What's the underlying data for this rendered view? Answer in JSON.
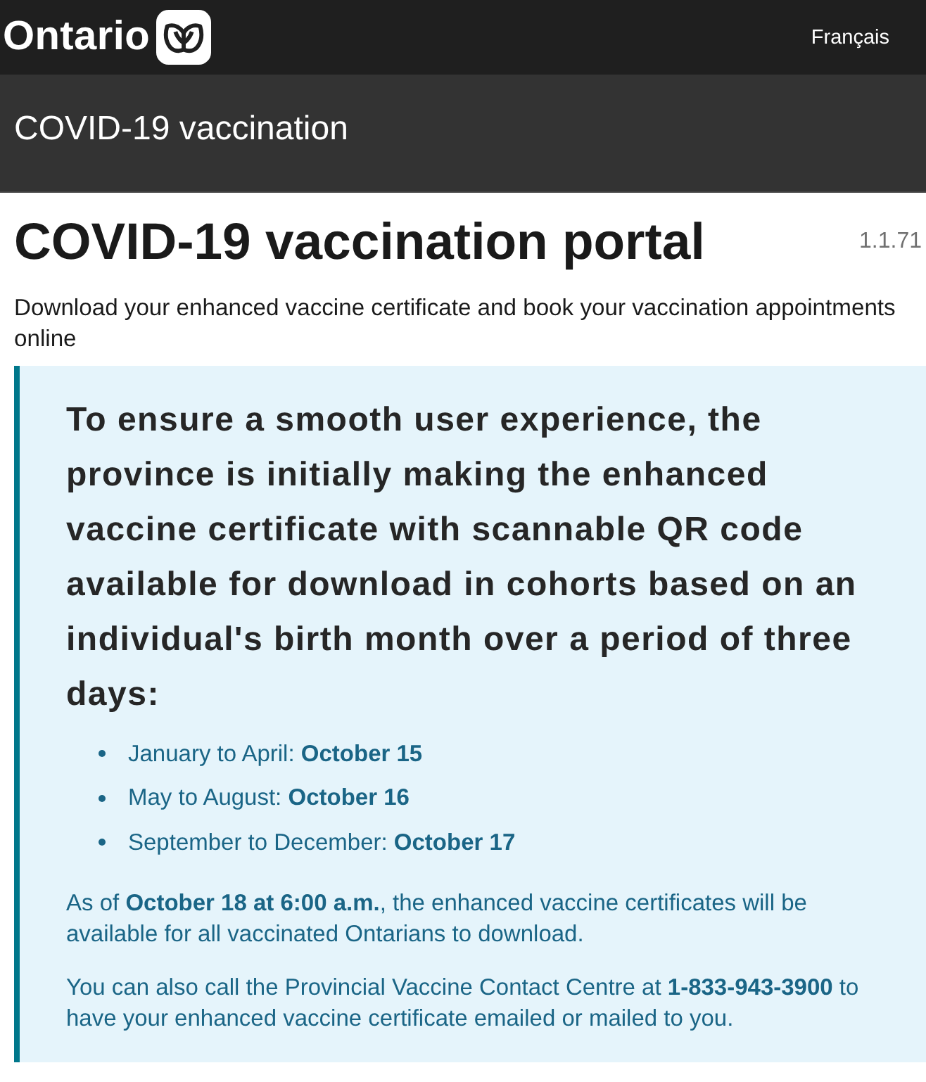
{
  "header": {
    "logo_text": "Ontario",
    "language_link": "Français"
  },
  "banner": {
    "title": "COVID-19 vaccination"
  },
  "intro": {
    "title": "COVID-19 vaccination portal",
    "version": "1.1.71",
    "subtitle": "Download your enhanced vaccine certificate and book your vaccination appointments online"
  },
  "notice": {
    "heading": "To ensure a smooth user experience, the province is initially making the enhanced vaccine certificate with scannable QR code available for download in cohorts based on an individual's birth month over a period of three days:",
    "schedule": [
      "January to April: **October 15**",
      "May to August: **October 16**",
      "September to December: **October 17**"
    ],
    "paragraphs": [
      "As of **October 18 at 6:00 a.m.**, the enhanced vaccine certificates will be available for all vaccinated Ontarians to download.",
      "You can also call the Provincial Vaccine Contact Centre at **1-833-943-3900** to have your enhanced vaccine certificate emailed or mailed to you."
    ]
  }
}
